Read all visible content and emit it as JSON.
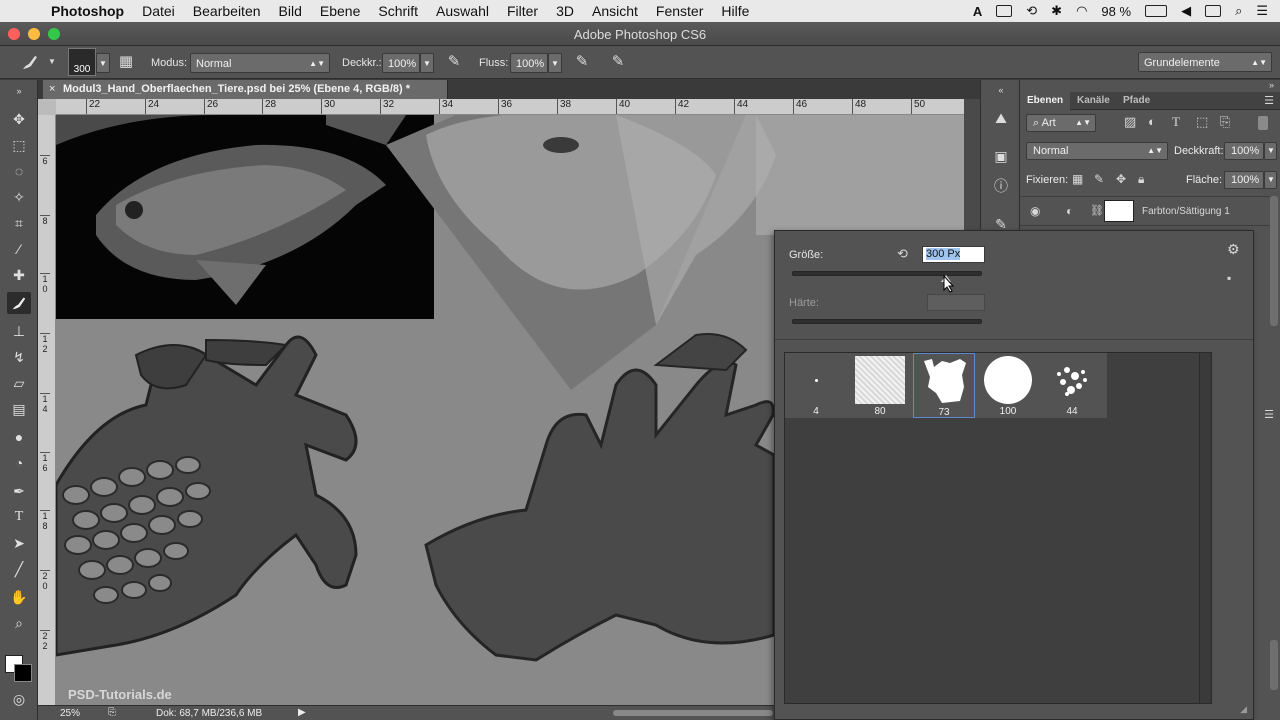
{
  "menubar": {
    "app": "Photoshop",
    "items": [
      "Datei",
      "Bearbeiten",
      "Bild",
      "Ebene",
      "Schrift",
      "Auswahl",
      "Filter",
      "3D",
      "Ansicht",
      "Fenster",
      "Hilfe"
    ],
    "battery": "98 %"
  },
  "window": {
    "title": "Adobe Photoshop CS6"
  },
  "options": {
    "brush_size": "300",
    "mode_label": "Modus:",
    "mode_value": "Normal",
    "opacity_label": "Deckkr.:",
    "opacity_value": "100%",
    "flow_label": "Fluss:",
    "flow_value": "100%",
    "workspace": "Grundelemente"
  },
  "document": {
    "tab_title": "Modul3_Hand_Oberflaechen_Tiere.psd bei 25% (Ebene 4, RGB/8) *",
    "close_glyph": "×",
    "ruler_h": [
      "22",
      "24",
      "26",
      "28",
      "30",
      "32",
      "34",
      "36",
      "38",
      "40",
      "42",
      "44",
      "46",
      "48",
      "50"
    ],
    "ruler_v": [
      "6",
      "8",
      "1\n0",
      "1\n2",
      "1\n4",
      "1\n6",
      "1\n8",
      "2\n0",
      "2\n2"
    ]
  },
  "status": {
    "zoom": "25%",
    "doc": "Dok: 68,7 MB/236,6 MB"
  },
  "layers": {
    "tabs": [
      "Ebenen",
      "Kanäle",
      "Pfade"
    ],
    "filter_kind": "Art",
    "blend_mode": "Normal",
    "opacity_label": "Deckkraft:",
    "opacity_value": "100%",
    "lock_label": "Fixieren:",
    "fill_label": "Fläche:",
    "fill_value": "100%",
    "layer_name": "Farbton/Sättigung 1"
  },
  "brush_popup": {
    "size_label": "Größe:",
    "size_value": "300 Px",
    "hardness_label": "Härte:",
    "presets": [
      "4",
      "80",
      "73",
      "100",
      "44"
    ]
  },
  "watermark": "PSD-Tutorials.de"
}
